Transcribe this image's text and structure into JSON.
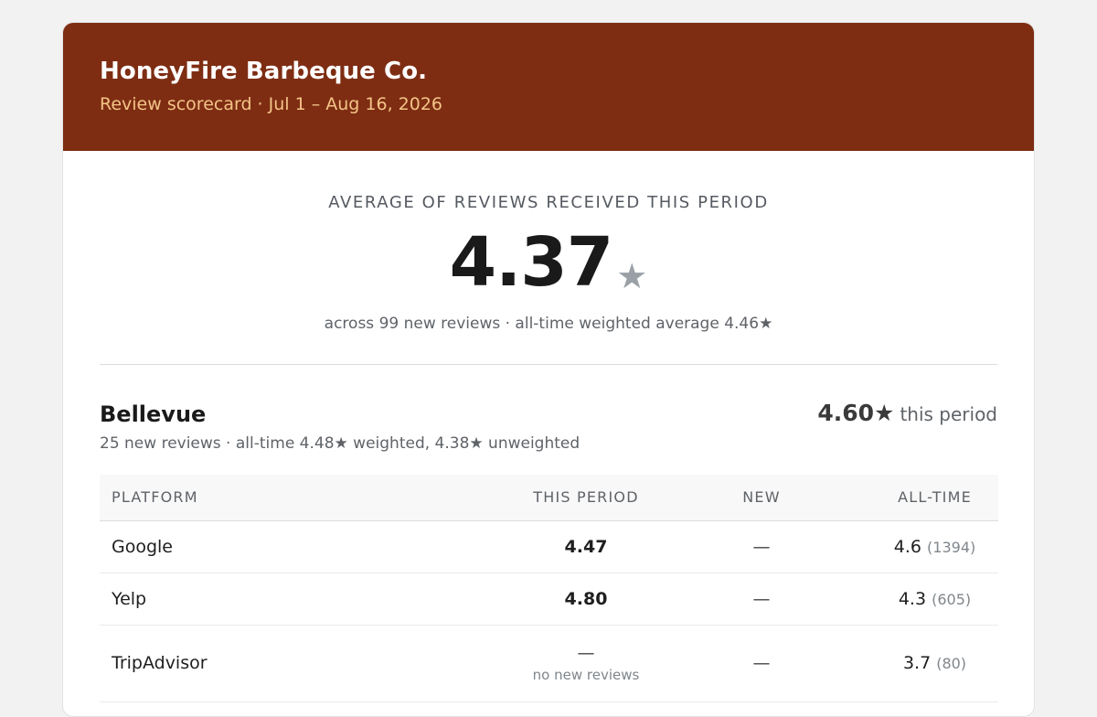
{
  "header": {
    "brand": "HoneyFire Barbeque Co.",
    "subtitle": "Review scorecard · Jul 1 – Aug 16, 2026"
  },
  "summary": {
    "label": "AVERAGE OF REVIEWS RECEIVED THIS PERIOD",
    "score": "4.37",
    "star": "★",
    "sub": "across 99 new reviews · all-time weighted average 4.46★"
  },
  "location": {
    "name": "Bellevue",
    "score": "4.60★",
    "score_suffix": "this period",
    "sub": "25 new reviews · all-time 4.48★ weighted, 4.38★ unweighted",
    "table": {
      "headers": [
        "PLATFORM",
        "THIS PERIOD",
        "NEW",
        "ALL-TIME"
      ],
      "rows": [
        {
          "platform": "Google",
          "period": "4.47",
          "new": "—",
          "alltime": "4.6",
          "count": "(1394)"
        },
        {
          "platform": "Yelp",
          "period": "4.80",
          "new": "—",
          "alltime": "4.3",
          "count": "(605)"
        },
        {
          "platform": "TripAdvisor",
          "period": "—",
          "period_note": "no new reviews",
          "new": "—",
          "alltime": "3.7",
          "count": "(80)"
        }
      ]
    }
  },
  "colors": {
    "header_bg": "#7e2d13",
    "subtitle": "#f4c487",
    "page_bg": "#f2f2f2"
  }
}
